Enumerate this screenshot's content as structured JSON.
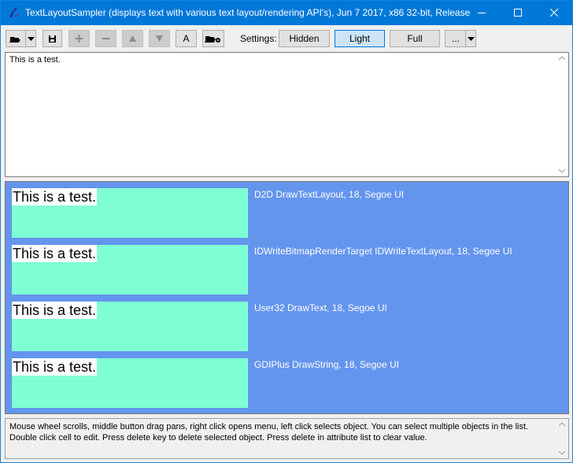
{
  "window": {
    "title": "TextLayoutSampler (displays text with various text layout/rendering API's), Jun  7 2017, x86 32-bit, Release"
  },
  "toolbar": {
    "settings_label": "Settings:",
    "font_button_label": "A",
    "buttons": [
      {
        "name": "Hidden",
        "selected": false
      },
      {
        "name": "Light",
        "selected": true
      },
      {
        "name": "Full",
        "selected": false
      }
    ],
    "more_label": "..."
  },
  "editor": {
    "text": "This is a test."
  },
  "render": {
    "background": "#6495ed",
    "sample_fill": "#7fffd4",
    "samples": [
      {
        "text": "This is a test.",
        "label": "D2D DrawTextLayout, 18, Segoe UI"
      },
      {
        "text": "This is a test.",
        "label": "IDWriteBitmapRenderTarget IDWriteTextLayout, 18, Segoe UI"
      },
      {
        "text": "This is a test.",
        "label": "User32 DrawText, 18, Segoe UI"
      },
      {
        "text": "This is a test.",
        "label": "GDIPlus DrawString, 18, Segoe UI"
      }
    ]
  },
  "status": {
    "line1": "Mouse wheel scrolls, middle button drag pans, right click opens menu, left click selects object. You can select multiple objects in the list.",
    "line2": "Double click cell to edit. Press delete key to delete selected object. Press delete in attribute list to clear value."
  },
  "colors": {
    "titlebar": "#0078d7",
    "accent": "#0078d7"
  }
}
